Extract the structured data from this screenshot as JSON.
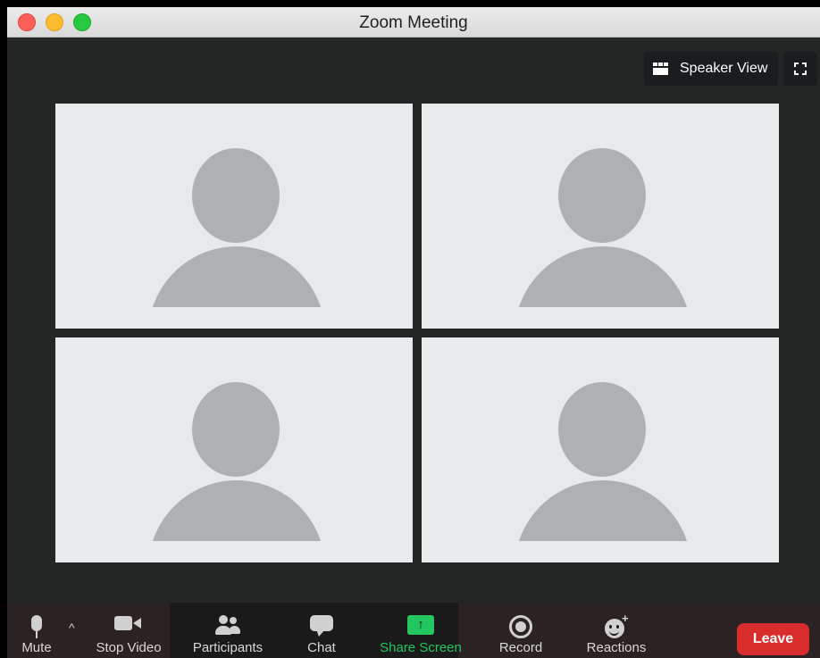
{
  "window": {
    "title": "Zoom Meeting"
  },
  "top_controls": {
    "speaker_view_label": "Speaker View"
  },
  "participants_tiles": [
    {
      "avatar": "default-avatar"
    },
    {
      "avatar": "default-avatar"
    },
    {
      "avatar": "default-avatar"
    },
    {
      "avatar": "default-avatar"
    }
  ],
  "toolbar": {
    "mute_label": "Mute",
    "stop_video_label": "Stop Video",
    "participants_label": "Participants",
    "chat_label": "Chat",
    "share_screen_label": "Share Screen",
    "record_label": "Record",
    "reactions_label": "Reactions",
    "leave_label": "Leave"
  },
  "colors": {
    "share_accent": "#22c55e",
    "leave_red": "#d92d2d",
    "meeting_bg": "#242625",
    "tile_bg": "#e8e9ea",
    "avatar_gray": "#aeb1b4"
  }
}
